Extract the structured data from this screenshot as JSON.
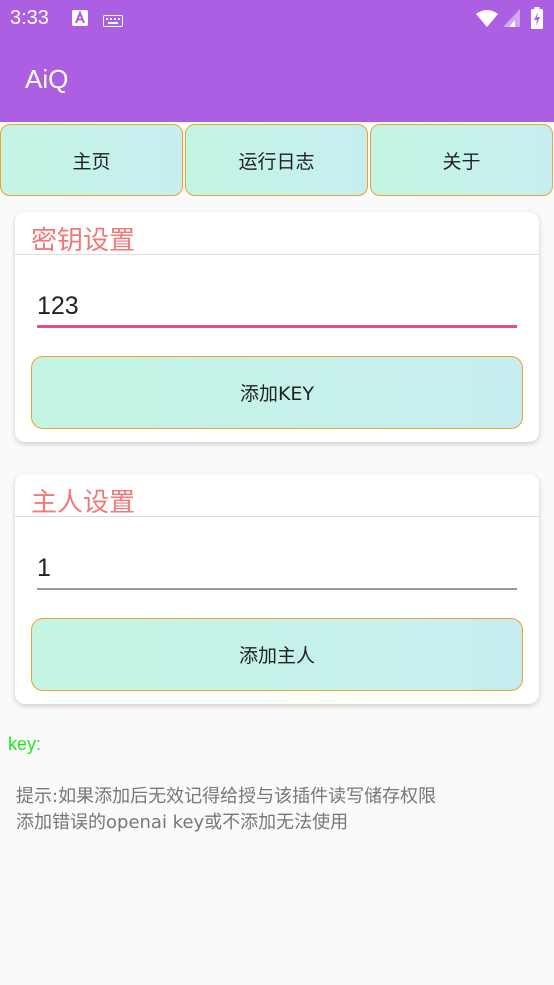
{
  "status_bar": {
    "time": "3:33",
    "icons": [
      "a-square-icon",
      "keyboard-icon",
      "wifi-icon",
      "signal-icon",
      "battery-charging-icon"
    ]
  },
  "app_bar": {
    "title": "AiQ"
  },
  "tabs": [
    {
      "label": "主页"
    },
    {
      "label": "运行日志"
    },
    {
      "label": "关于"
    }
  ],
  "key_settings": {
    "title": "密钥设置",
    "input_value": "123",
    "button_label": "添加KEY"
  },
  "owner_settings": {
    "title": "主人设置",
    "input_value": "1",
    "button_label": "添加主人"
  },
  "key_label": "key:",
  "hint_lines": [
    "提示:如果添加后无效记得给授与该插件读写储存权限",
    "添加错误的openai key或不添加无法使用"
  ],
  "colors": {
    "accent": "#ad5fe3",
    "card_title": "#f07a7a",
    "button_border": "#f0a030",
    "active_underline": "#ec4a8a",
    "key_label": "#22e522"
  }
}
